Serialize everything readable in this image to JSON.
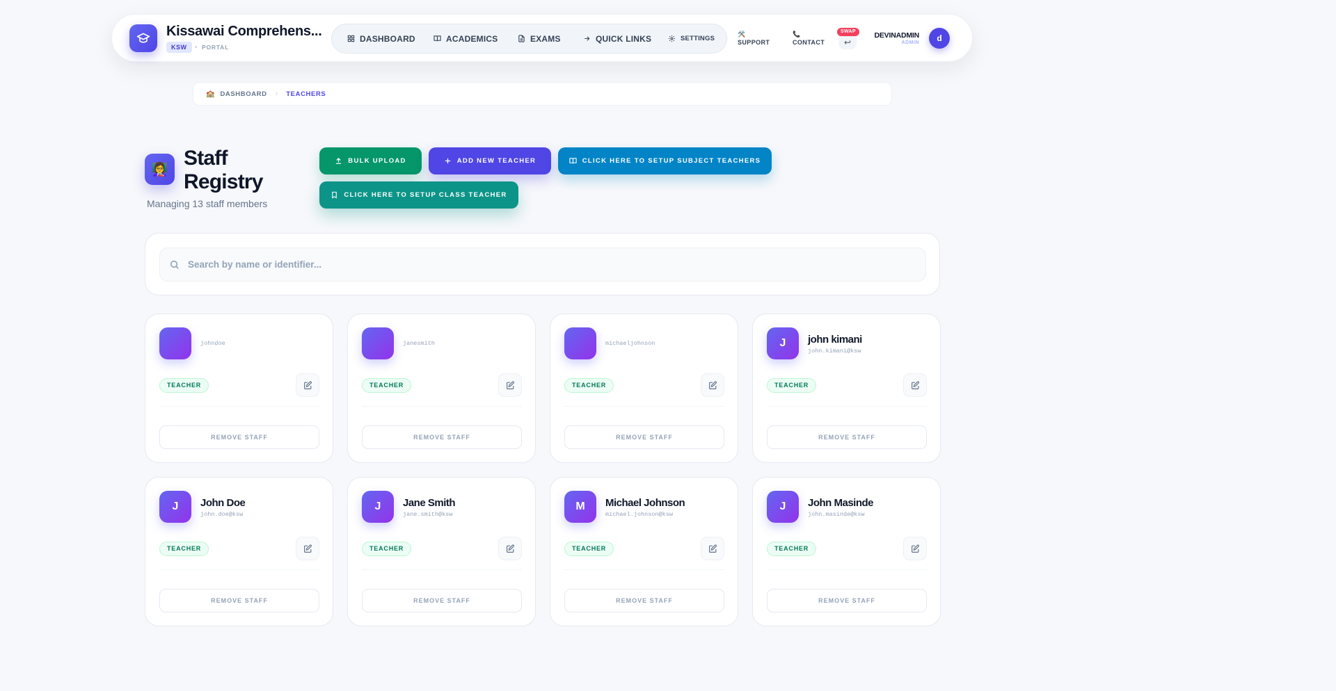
{
  "header": {
    "school_name": "Kissawai Comprehens...",
    "school_code": "KSW",
    "portal_label": "PORTAL",
    "nav": [
      {
        "label": "DASHBOARD",
        "icon": "grid-icon"
      },
      {
        "label": "ACADEMICS",
        "icon": "book-icon"
      },
      {
        "label": "EXAMS",
        "icon": "file-icon"
      },
      {
        "label": "QUICK LINKS",
        "icon": "arrow-right-icon"
      },
      {
        "label": "SETTINGS",
        "icon": "gear-icon"
      }
    ],
    "support": {
      "emoji": "🛠️",
      "label": "SUPPORT"
    },
    "contact": {
      "emoji": "📞",
      "label": "CONTACT"
    },
    "swap_badge": "SWAP",
    "swap_glyph": "↩",
    "user": {
      "name": "DEVINADMIN",
      "role": "ADMIN",
      "initial": "d"
    }
  },
  "breadcrumb": {
    "home_emoji": "🏫",
    "home": "DASHBOARD",
    "current": "TEACHERS"
  },
  "page": {
    "icon_emoji": "👩‍🏫",
    "title": "Staff Registry",
    "subtitle": "Managing 13 staff members"
  },
  "actions": {
    "bulk_upload": "BULK UPLOAD",
    "add_teacher": "ADD NEW TEACHER",
    "subject_teachers": "CLICK HERE TO SETUP SUBJECT TEACHERS",
    "class_teacher": "CLICK HERE TO SETUP CLASS TEACHER"
  },
  "search": {
    "placeholder": "Search by name or identifier..."
  },
  "staff": [
    {
      "initial": "",
      "name": "",
      "email": "johndoe",
      "role": "TEACHER",
      "remove_label": "REMOVE STAFF"
    },
    {
      "initial": "",
      "name": "",
      "email": "janesmith",
      "role": "TEACHER",
      "remove_label": "REMOVE STAFF"
    },
    {
      "initial": "",
      "name": "",
      "email": "michaeljohnson",
      "role": "TEACHER",
      "remove_label": "REMOVE STAFF"
    },
    {
      "initial": "J",
      "name": "john kimani",
      "email": "john.kimani@ksw",
      "role": "TEACHER",
      "remove_label": "REMOVE STAFF"
    },
    {
      "initial": "J",
      "name": "John Doe",
      "email": "john.doe@ksw",
      "role": "TEACHER",
      "remove_label": "REMOVE STAFF"
    },
    {
      "initial": "J",
      "name": "Jane Smith",
      "email": "jane.smith@ksw",
      "role": "TEACHER",
      "remove_label": "REMOVE STAFF"
    },
    {
      "initial": "M",
      "name": "Michael Johnson",
      "email": "michael.johnson@ksw",
      "role": "TEACHER",
      "remove_label": "REMOVE STAFF"
    },
    {
      "initial": "J",
      "name": "John Masinde",
      "email": "john.masinde@ksw",
      "role": "TEACHER",
      "remove_label": "REMOVE STAFF"
    }
  ]
}
